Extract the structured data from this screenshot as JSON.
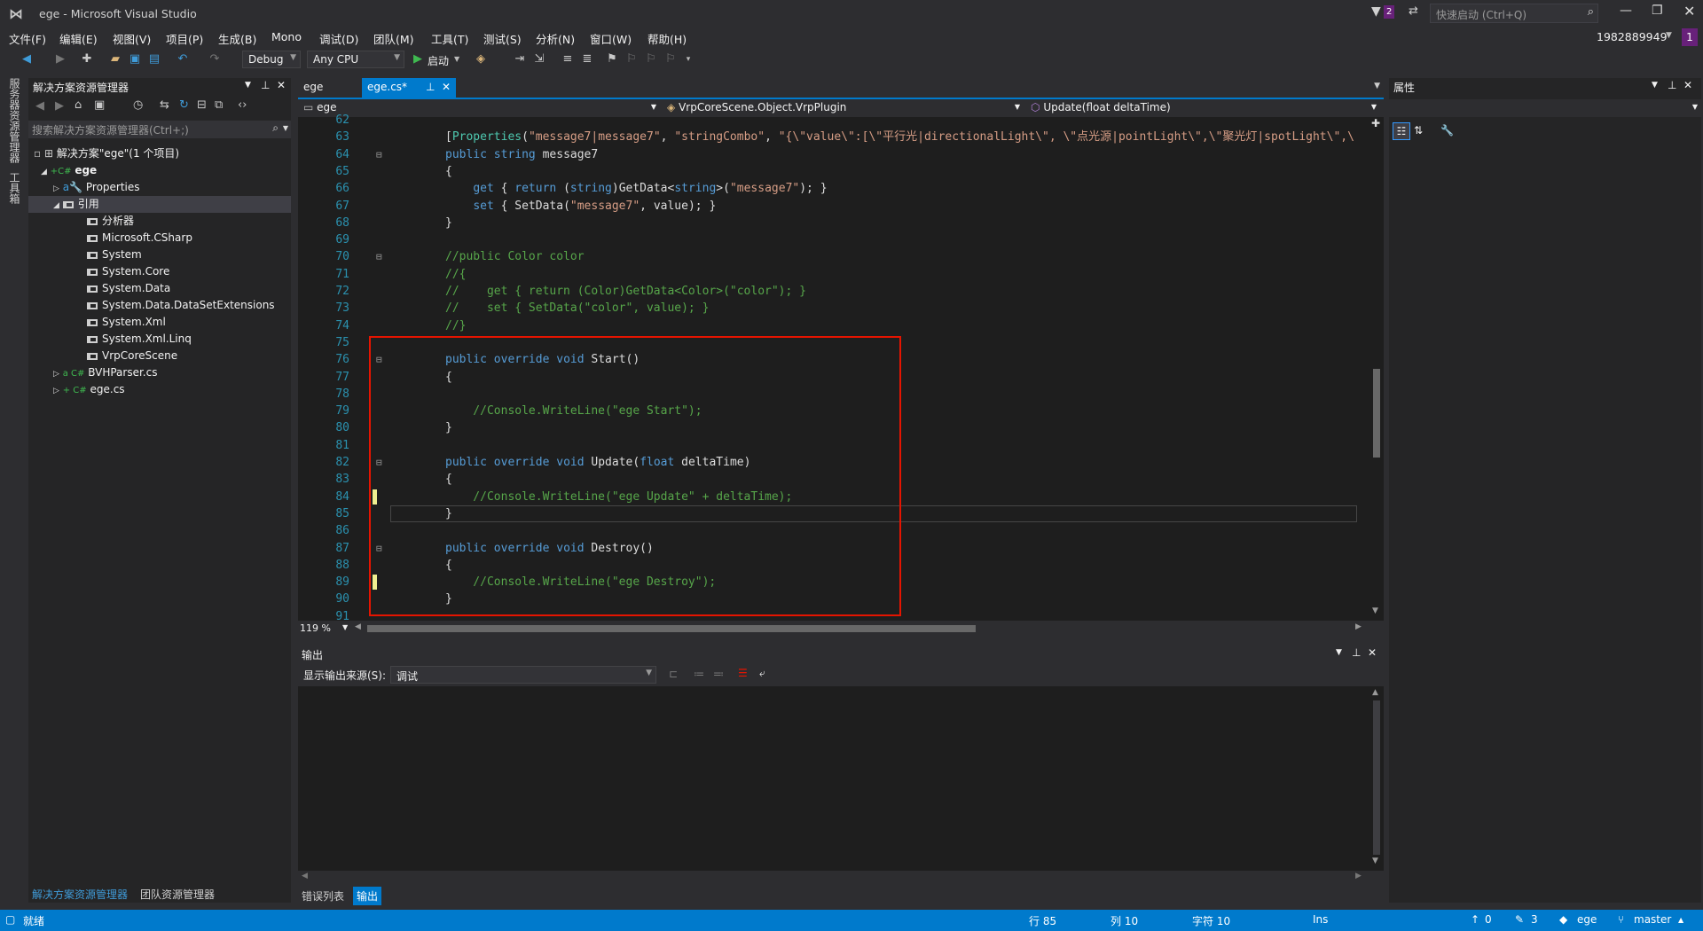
{
  "window": {
    "title": "ege - Microsoft Visual Studio",
    "quick_launch": "快速启动 (Ctrl+Q)",
    "user": "1982889949",
    "notif": "2",
    "badge": "1"
  },
  "menu": [
    "文件(F)",
    "编辑(E)",
    "视图(V)",
    "项目(P)",
    "生成(B)",
    "Mono",
    "调试(D)",
    "团队(M)",
    "工具(T)",
    "测试(S)",
    "分析(N)",
    "窗口(W)",
    "帮助(H)"
  ],
  "toolbar": {
    "config": "Debug",
    "platform": "Any CPU",
    "start": "启动"
  },
  "left_strip": {
    "tab1": "服务器资源管理器",
    "tab2": "工具箱"
  },
  "solution_explorer": {
    "title": "解决方案资源管理器",
    "search": "搜索解决方案资源管理器(Ctrl+;)",
    "items": [
      {
        "label": "解决方案\"ege\"(1 个项目)",
        "indent": 1,
        "icon": "solution-icon"
      },
      {
        "label": "ege",
        "indent": 2,
        "icon": "csharp-project-icon",
        "bold": true
      },
      {
        "label": "Properties",
        "indent": 3,
        "icon": "wrench-icon"
      },
      {
        "label": "引用",
        "indent": 3,
        "icon": "reference-icon",
        "selected": true
      },
      {
        "label": "分析器",
        "indent": 4,
        "icon": "analyzer-icon"
      },
      {
        "label": "Microsoft.CSharp",
        "indent": 4,
        "icon": "reference-icon"
      },
      {
        "label": "System",
        "indent": 4,
        "icon": "reference-icon"
      },
      {
        "label": "System.Core",
        "indent": 4,
        "icon": "reference-icon"
      },
      {
        "label": "System.Data",
        "indent": 4,
        "icon": "reference-icon"
      },
      {
        "label": "System.Data.DataSetExtensions",
        "indent": 4,
        "icon": "reference-icon"
      },
      {
        "label": "System.Xml",
        "indent": 4,
        "icon": "reference-icon"
      },
      {
        "label": "System.Xml.Linq",
        "indent": 4,
        "icon": "reference-icon"
      },
      {
        "label": "VrpCoreScene",
        "indent": 4,
        "icon": "reference-icon"
      },
      {
        "label": "BVHParser.cs",
        "indent": 3,
        "icon": "csharp-file-icon"
      },
      {
        "label": "ege.cs",
        "indent": 3,
        "icon": "csharp-file-icon"
      }
    ],
    "bottom_tabs": [
      "解决方案资源管理器",
      "团队资源管理器"
    ]
  },
  "editor": {
    "tabs": [
      {
        "label": "ege"
      },
      {
        "label": "ege.cs*",
        "active": true
      }
    ],
    "nav": {
      "project": "ege",
      "class": "VrpCoreScene.Object.VrpPlugin",
      "member": "Update(float deltaTime)"
    },
    "zoom": "119 %",
    "lines": [
      {
        "n": "62",
        "t": ""
      },
      {
        "n": "63",
        "t": "[Properties(\"message7|message7\", \"stringCombo\", \"{\\\"value\\\":[\\\"平行光|directionalLight\\\", \\\"点光源|pointLight\\\",\\\"聚光灯|spotLight\\\",\\"
      },
      {
        "n": "64",
        "t": "public string message7"
      },
      {
        "n": "65",
        "t": "{"
      },
      {
        "n": "66",
        "t": "    get { return (string)GetData<string>(\"message7\"); }"
      },
      {
        "n": "67",
        "t": "    set { SetData(\"message7\", value); }"
      },
      {
        "n": "68",
        "t": "}"
      },
      {
        "n": "69",
        "t": ""
      },
      {
        "n": "70",
        "t": "//public Color color"
      },
      {
        "n": "71",
        "t": "//{"
      },
      {
        "n": "72",
        "t": "//    get { return (Color)GetData<Color>(\"color\"); }"
      },
      {
        "n": "73",
        "t": "//    set { SetData(\"color\", value); }"
      },
      {
        "n": "74",
        "t": "//}"
      },
      {
        "n": "75",
        "t": ""
      },
      {
        "n": "76",
        "t": "public override void Start()"
      },
      {
        "n": "77",
        "t": "{"
      },
      {
        "n": "78",
        "t": ""
      },
      {
        "n": "79",
        "t": "    //Console.WriteLine(\"ege Start\");"
      },
      {
        "n": "80",
        "t": "}"
      },
      {
        "n": "81",
        "t": ""
      },
      {
        "n": "82",
        "t": "public override void Update(float deltaTime)"
      },
      {
        "n": "83",
        "t": "{"
      },
      {
        "n": "84",
        "t": "    //Console.WriteLine(\"ege Update\" + deltaTime);"
      },
      {
        "n": "85",
        "t": "}"
      },
      {
        "n": "86",
        "t": ""
      },
      {
        "n": "87",
        "t": "public override void Destroy()"
      },
      {
        "n": "88",
        "t": "{"
      },
      {
        "n": "89",
        "t": "    //Console.WriteLine(\"ege Destroy\");"
      },
      {
        "n": "90",
        "t": "}"
      },
      {
        "n": "91",
        "t": ""
      }
    ]
  },
  "properties": {
    "title": "属性"
  },
  "output": {
    "title": "输出",
    "source_label": "显示输出来源(S):",
    "source_value": "调试",
    "bottom_tabs": [
      "错误列表",
      "输出"
    ]
  },
  "status": {
    "ready": "就绪",
    "line": "行 85",
    "col": "列 10",
    "char": "字符 10",
    "mode": "Ins",
    "up": "0",
    "edits": "3",
    "repo": "ege",
    "branch": "master"
  },
  "colors": {
    "accent": "#007acc",
    "highlight_box": "#e51400"
  }
}
